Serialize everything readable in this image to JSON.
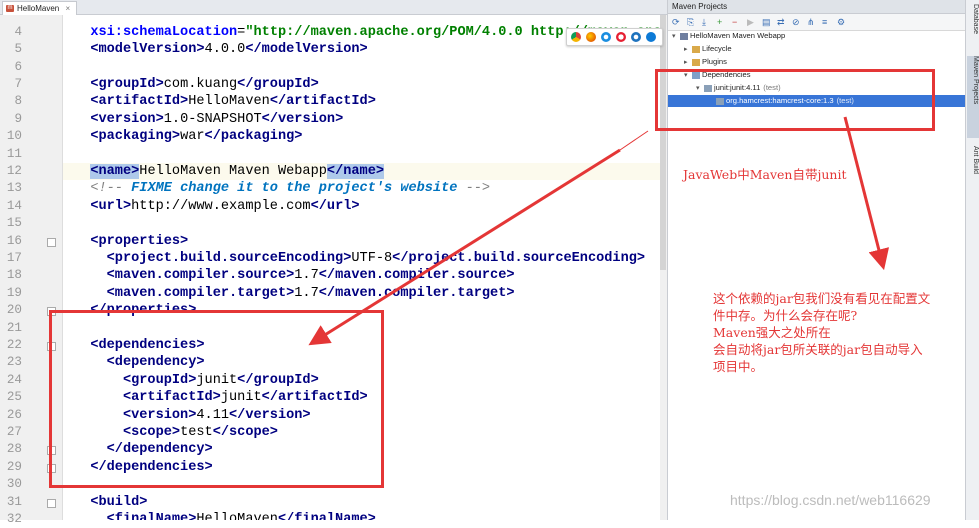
{
  "tab": {
    "label": "HelloMaven",
    "close": "×"
  },
  "editor": {
    "lines": [
      {
        "n": "4",
        "frag": [
          [
            "  ",
            ""
          ],
          [
            "xsi:schemaLocation",
            "attr"
          ],
          [
            "=",
            ""
          ],
          [
            "\"http://maven.apache.org/POM/4.0.0 http://maven.apache",
            "str"
          ]
        ]
      },
      {
        "n": "5",
        "frag": [
          [
            "  ",
            ""
          ],
          [
            "<modelVersion>",
            "tag"
          ],
          [
            "4.0.0",
            ""
          ],
          [
            "</modelVersion>",
            "tag"
          ]
        ]
      },
      {
        "n": "6",
        "frag": []
      },
      {
        "n": "7",
        "frag": [
          [
            "  ",
            ""
          ],
          [
            "<groupId>",
            "tag"
          ],
          [
            "com.kuang",
            ""
          ],
          [
            "</groupId>",
            "tag"
          ]
        ]
      },
      {
        "n": "8",
        "frag": [
          [
            "  ",
            ""
          ],
          [
            "<artifactId>",
            "tag"
          ],
          [
            "HelloMaven",
            ""
          ],
          [
            "</artifactId>",
            "tag"
          ]
        ]
      },
      {
        "n": "9",
        "frag": [
          [
            "  ",
            ""
          ],
          [
            "<version>",
            "tag"
          ],
          [
            "1.0-SNAPSHOT",
            ""
          ],
          [
            "</version>",
            "tag"
          ]
        ]
      },
      {
        "n": "10",
        "frag": [
          [
            "  ",
            ""
          ],
          [
            "<packaging>",
            "tag"
          ],
          [
            "war",
            ""
          ],
          [
            "</packaging>",
            "tag"
          ]
        ]
      },
      {
        "n": "11",
        "frag": []
      },
      {
        "n": "12",
        "frag": [
          [
            "  ",
            ""
          ],
          [
            "<name>",
            "tag hl"
          ],
          [
            "HelloMaven Maven Webapp",
            ""
          ],
          [
            "</name>",
            "tag hl"
          ]
        ]
      },
      {
        "n": "13",
        "frag": [
          [
            "  ",
            ""
          ],
          [
            "<!-- ",
            "cmt"
          ],
          [
            "FIXME change it to the project's website",
            "todo"
          ],
          [
            " -->",
            "cmt"
          ]
        ]
      },
      {
        "n": "14",
        "frag": [
          [
            "  ",
            ""
          ],
          [
            "<url>",
            "tag"
          ],
          [
            "http://www.example.com",
            ""
          ],
          [
            "</url>",
            "tag"
          ]
        ]
      },
      {
        "n": "15",
        "frag": []
      },
      {
        "n": "16",
        "frag": [
          [
            "  ",
            ""
          ],
          [
            "<properties>",
            "tag"
          ]
        ]
      },
      {
        "n": "17",
        "frag": [
          [
            "    ",
            ""
          ],
          [
            "<project.build.sourceEncoding>",
            "tag"
          ],
          [
            "UTF-8",
            ""
          ],
          [
            "</project.build.sourceEncoding>",
            "tag"
          ]
        ]
      },
      {
        "n": "18",
        "frag": [
          [
            "    ",
            ""
          ],
          [
            "<maven.compiler.source>",
            "tag"
          ],
          [
            "1.7",
            ""
          ],
          [
            "</maven.compiler.source>",
            "tag"
          ]
        ]
      },
      {
        "n": "19",
        "frag": [
          [
            "    ",
            ""
          ],
          [
            "<maven.compiler.target>",
            "tag"
          ],
          [
            "1.7",
            ""
          ],
          [
            "</maven.compiler.target>",
            "tag"
          ]
        ]
      },
      {
        "n": "20",
        "frag": [
          [
            "  ",
            ""
          ],
          [
            "</properties>",
            "tag"
          ]
        ]
      },
      {
        "n": "21",
        "frag": []
      },
      {
        "n": "22",
        "frag": [
          [
            "  ",
            ""
          ],
          [
            "<dependencies>",
            "tag"
          ]
        ]
      },
      {
        "n": "23",
        "frag": [
          [
            "    ",
            ""
          ],
          [
            "<dependency>",
            "tag"
          ]
        ]
      },
      {
        "n": "24",
        "frag": [
          [
            "      ",
            ""
          ],
          [
            "<groupId>",
            "tag"
          ],
          [
            "junit",
            ""
          ],
          [
            "</groupId>",
            "tag"
          ]
        ]
      },
      {
        "n": "25",
        "frag": [
          [
            "      ",
            ""
          ],
          [
            "<artifactId>",
            "tag"
          ],
          [
            "junit",
            ""
          ],
          [
            "</artifactId>",
            "tag"
          ]
        ]
      },
      {
        "n": "26",
        "frag": [
          [
            "      ",
            ""
          ],
          [
            "<version>",
            "tag"
          ],
          [
            "4.11",
            ""
          ],
          [
            "</version>",
            "tag"
          ]
        ]
      },
      {
        "n": "27",
        "frag": [
          [
            "      ",
            ""
          ],
          [
            "<scope>",
            "tag"
          ],
          [
            "test",
            ""
          ],
          [
            "</scope>",
            "tag"
          ]
        ]
      },
      {
        "n": "28",
        "frag": [
          [
            "    ",
            ""
          ],
          [
            "</dependency>",
            "tag"
          ]
        ]
      },
      {
        "n": "29",
        "frag": [
          [
            "  ",
            ""
          ],
          [
            "</dependencies>",
            "tag"
          ]
        ]
      },
      {
        "n": "30",
        "frag": []
      },
      {
        "n": "31",
        "frag": [
          [
            "  ",
            ""
          ],
          [
            "<build>",
            "tag"
          ]
        ]
      },
      {
        "n": "32",
        "frag": [
          [
            "    ",
            ""
          ],
          [
            "<finalName>",
            "tag"
          ],
          [
            "HelloMaven",
            ""
          ],
          [
            "</finalName>",
            "tag"
          ]
        ]
      }
    ]
  },
  "panel": {
    "title": "Maven Projects",
    "toolbar_icons": [
      "refresh-icon",
      "generate-sources-icon",
      "download-icon",
      "add-icon",
      "minus-icon",
      "run-icon",
      "run-config-icon",
      "toggle-offline-icon",
      "skip-tests-icon",
      "show-dependencies-icon",
      "collapse-icon",
      "settings-icon"
    ],
    "tree": [
      {
        "label": "HelloMaven Maven Webapp",
        "sub": "",
        "depth": 0,
        "arrow": "▾"
      },
      {
        "label": "Lifecycle",
        "sub": "",
        "depth": 1,
        "arrow": "▸"
      },
      {
        "label": "Plugins",
        "sub": "",
        "depth": 1,
        "arrow": "▸"
      },
      {
        "label": "Dependencies",
        "sub": "",
        "depth": 1,
        "arrow": "▾"
      },
      {
        "label": "junit:junit:4.11",
        "sub": "(test)",
        "depth": 2,
        "arrow": "▾"
      },
      {
        "label": "org.hamcrest:hamcrest-core:1.3",
        "sub": "(test)",
        "depth": 3,
        "arrow": ""
      }
    ]
  },
  "side_tabs": [
    "Database",
    "Maven Projects",
    "Ant Build"
  ],
  "annotations": {
    "note1": "JavaWeb中Maven自带junit",
    "note2": [
      "这个依赖的jar包我们没有看见在配置文",
      "件中存。为什么会存在呢?",
      "Maven强大之处所在",
      "会自动将jar包所关联的jar包自动导入",
      "项目中。"
    ]
  },
  "watermark": "https://blog.csdn.net/web116629",
  "colors": {
    "annotation_red": "#e43636",
    "selection": "#3875d7"
  }
}
